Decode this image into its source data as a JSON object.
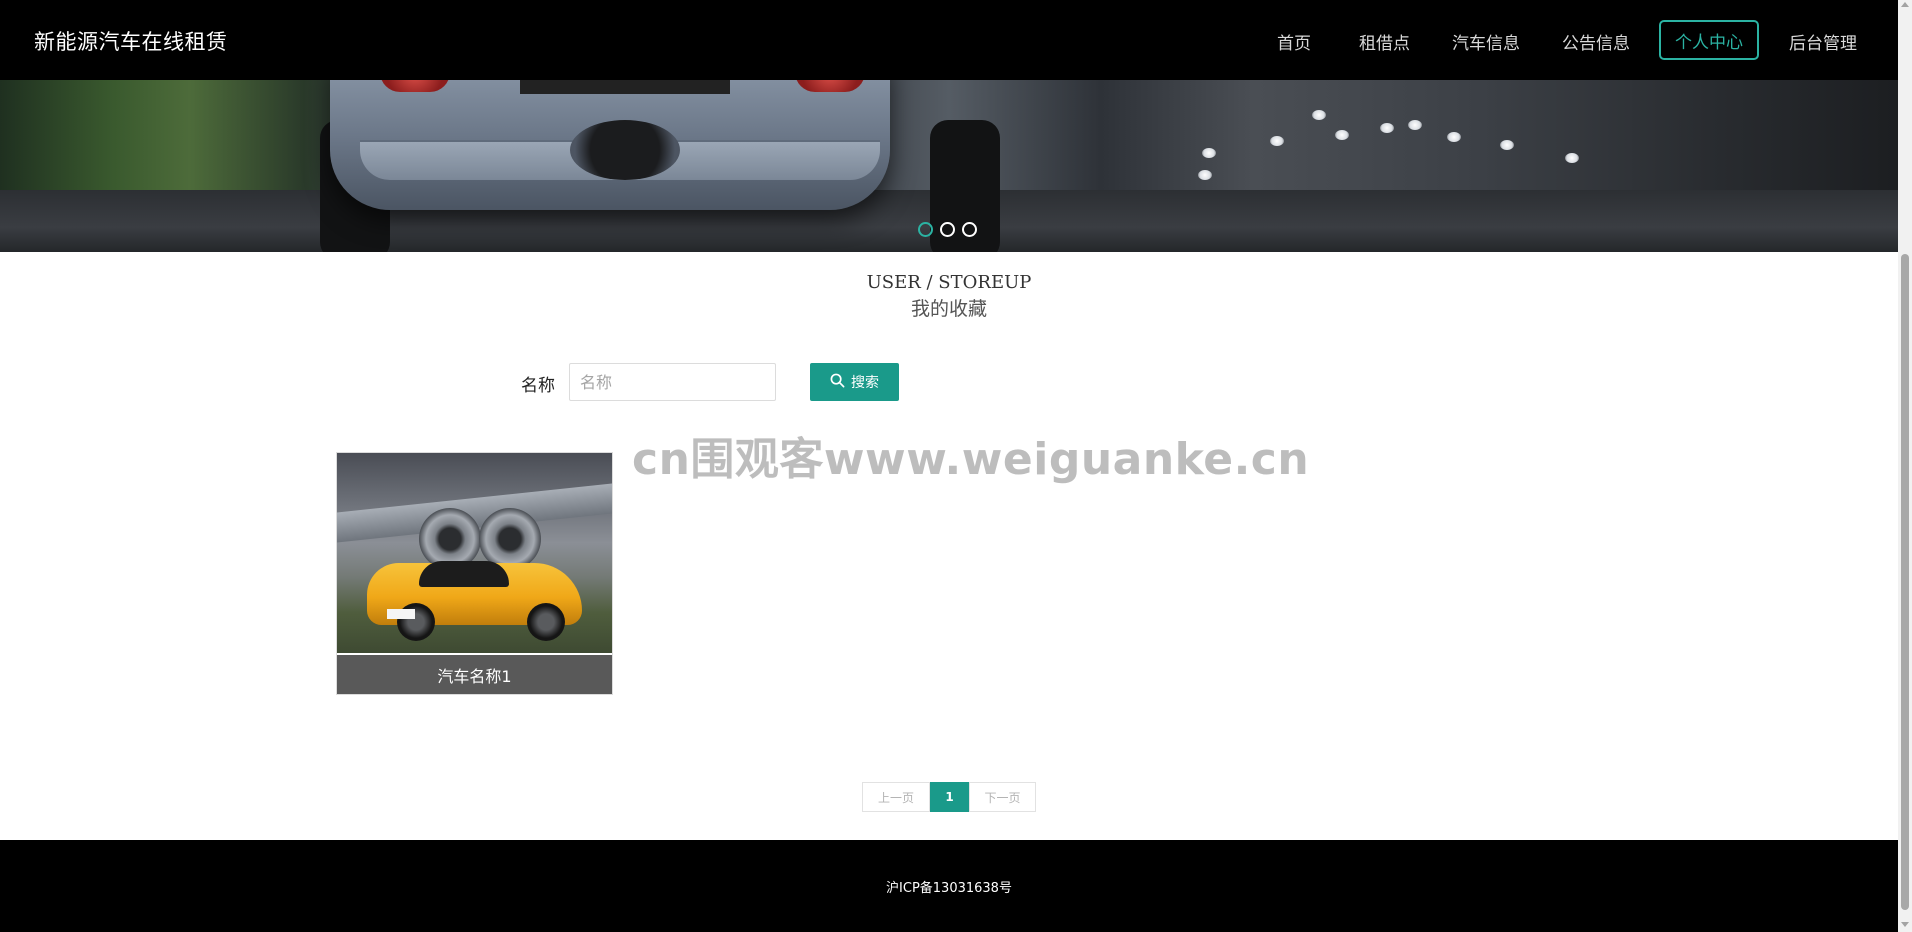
{
  "header": {
    "brand": "新能源汽车在线租赁",
    "nav": [
      "首页",
      "租借点",
      "汽车信息",
      "公告信息",
      "个人中心",
      "后台管理"
    ],
    "active_index": 4
  },
  "banner": {
    "dots": 3,
    "active_dot": 0
  },
  "section": {
    "title_en": "USER / STOREUP",
    "title_cn": "我的收藏"
  },
  "search": {
    "label": "名称",
    "placeholder": "名称",
    "value": "",
    "button_label": "搜索"
  },
  "watermark": "cn围观客www.weiguanke.cn",
  "items": [
    {
      "title": "汽车名称1"
    }
  ],
  "pagination": {
    "prev_label": "上一页",
    "current": "1",
    "next_label": "下一页"
  },
  "footer": {
    "icp": "沪ICP备13031638号"
  },
  "colors": {
    "accent": "#1a9a8a",
    "nav_active": "#2bb3a3",
    "header_bg": "#000000",
    "card_title_bg": "#595959"
  }
}
